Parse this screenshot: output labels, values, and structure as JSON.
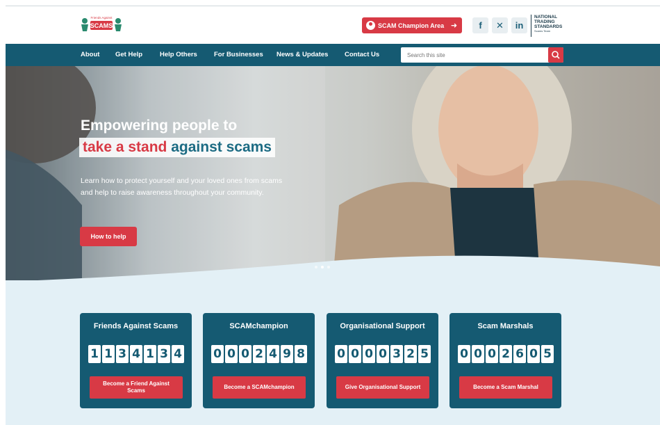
{
  "brand": {
    "logo_text": "SCAMS",
    "logo_caption": "Friends Against"
  },
  "header": {
    "champion_area_label": "SCAM Champion Area",
    "nts": {
      "line1": "NATIONAL",
      "line2": "TRADING",
      "line3": "STANDARDS",
      "sub": "Scams Team"
    }
  },
  "nav": {
    "items": [
      "About",
      "Get Help",
      "Help Others",
      "For Businesses",
      "News & Updates",
      "Contact Us"
    ],
    "search_placeholder": "Search this site"
  },
  "hero": {
    "title_line1": "Empowering people to",
    "title_red": "take a stand",
    "title_teal": "against scams",
    "description": "Learn how to protect yourself and your loved ones from scams and help to raise awareness throughout your community.",
    "button_label": "How to help"
  },
  "counters": [
    {
      "title": "Friends Against Scams",
      "value": "1134134",
      "button": "Become a Friend Against Scams"
    },
    {
      "title": "SCAMchampion",
      "value": "0002498",
      "button": "Become a SCAMchampion"
    },
    {
      "title": "Organisational Support",
      "value": "0000325",
      "button": "Give Organisational Support"
    },
    {
      "title": "Scam Marshals",
      "value": "0002605",
      "button": "Become a Scam Marshal"
    }
  ],
  "colors": {
    "accent": "#d83a45",
    "brand": "#155a72",
    "section_bg": "#e3f0f6"
  }
}
